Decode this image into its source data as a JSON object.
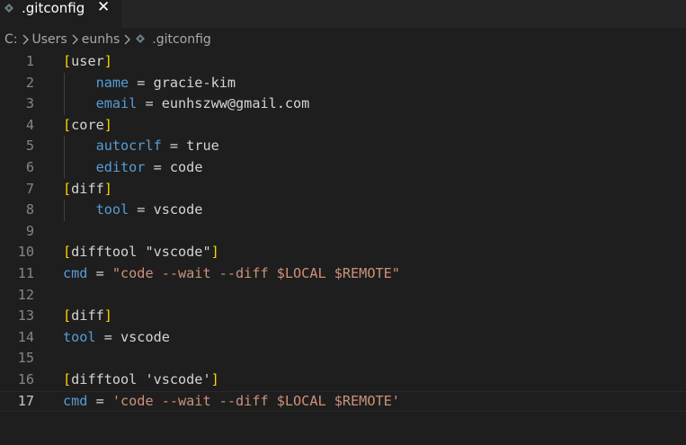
{
  "tab": {
    "title": ".gitconfig",
    "close_glyph": "✕",
    "icon": "gear-file-icon"
  },
  "breadcrumb": {
    "items": [
      "C:",
      "Users",
      "eunhs",
      ".gitconfig"
    ],
    "separator_icon": "chevron-right-icon"
  },
  "editor": {
    "current_line": 17,
    "lines": [
      {
        "n": "1",
        "indent": "",
        "tokens": [
          {
            "c": "t-bracket",
            "t": "["
          },
          {
            "c": "t-section",
            "t": "user"
          },
          {
            "c": "t-bracket",
            "t": "]"
          }
        ]
      },
      {
        "n": "2",
        "indent": "    ",
        "tokens": [
          {
            "c": "t-key",
            "t": "name"
          },
          {
            "c": "t-op",
            "t": " = "
          },
          {
            "c": "t-val",
            "t": "gracie-kim"
          }
        ]
      },
      {
        "n": "3",
        "indent": "    ",
        "tokens": [
          {
            "c": "t-key",
            "t": "email"
          },
          {
            "c": "t-op",
            "t": " = "
          },
          {
            "c": "t-val",
            "t": "eunhszww@gmail.com"
          }
        ]
      },
      {
        "n": "4",
        "indent": "",
        "tokens": [
          {
            "c": "t-bracket",
            "t": "["
          },
          {
            "c": "t-section",
            "t": "core"
          },
          {
            "c": "t-bracket",
            "t": "]"
          }
        ]
      },
      {
        "n": "5",
        "indent": "    ",
        "tokens": [
          {
            "c": "t-key",
            "t": "autocrlf"
          },
          {
            "c": "t-op",
            "t": " = "
          },
          {
            "c": "t-val",
            "t": "true"
          }
        ]
      },
      {
        "n": "6",
        "indent": "    ",
        "tokens": [
          {
            "c": "t-key",
            "t": "editor"
          },
          {
            "c": "t-op",
            "t": " = "
          },
          {
            "c": "t-val",
            "t": "code"
          }
        ]
      },
      {
        "n": "7",
        "indent": "",
        "tokens": [
          {
            "c": "t-bracket",
            "t": "["
          },
          {
            "c": "t-section",
            "t": "diff"
          },
          {
            "c": "t-bracket",
            "t": "]"
          }
        ]
      },
      {
        "n": "8",
        "indent": "    ",
        "tokens": [
          {
            "c": "t-key",
            "t": "tool"
          },
          {
            "c": "t-op",
            "t": " = "
          },
          {
            "c": "t-val",
            "t": "vscode"
          }
        ]
      },
      {
        "n": "9",
        "indent": "",
        "tokens": []
      },
      {
        "n": "10",
        "indent": "",
        "tokens": [
          {
            "c": "t-bracket",
            "t": "["
          },
          {
            "c": "t-section",
            "t": "difftool \"vscode\""
          },
          {
            "c": "t-bracket",
            "t": "]"
          }
        ]
      },
      {
        "n": "11",
        "indent": "",
        "tokens": [
          {
            "c": "t-key",
            "t": "cmd"
          },
          {
            "c": "t-op",
            "t": " = "
          },
          {
            "c": "t-str",
            "t": "\"code --wait --diff $LOCAL $REMOTE\""
          }
        ]
      },
      {
        "n": "12",
        "indent": "",
        "tokens": []
      },
      {
        "n": "13",
        "indent": "",
        "tokens": [
          {
            "c": "t-bracket",
            "t": "["
          },
          {
            "c": "t-section",
            "t": "diff"
          },
          {
            "c": "t-bracket",
            "t": "]"
          }
        ]
      },
      {
        "n": "14",
        "indent": "",
        "tokens": [
          {
            "c": "t-key",
            "t": "tool"
          },
          {
            "c": "t-op",
            "t": " = "
          },
          {
            "c": "t-val",
            "t": "vscode"
          }
        ]
      },
      {
        "n": "15",
        "indent": "",
        "tokens": []
      },
      {
        "n": "16",
        "indent": "",
        "tokens": [
          {
            "c": "t-bracket",
            "t": "["
          },
          {
            "c": "t-section",
            "t": "difftool 'vscode'"
          },
          {
            "c": "t-bracket",
            "t": "]"
          }
        ]
      },
      {
        "n": "17",
        "indent": "",
        "tokens": [
          {
            "c": "t-key",
            "t": "cmd"
          },
          {
            "c": "t-op",
            "t": " = "
          },
          {
            "c": "t-str",
            "t": "'code --wait --diff $LOCAL $REMOTE'"
          }
        ]
      }
    ]
  },
  "colors": {
    "background": "#1e1e1e",
    "key": "#569cd6",
    "bracket": "#ffd700",
    "string": "#ce9178",
    "text": "#d4d4d4",
    "line_number": "#858585"
  }
}
